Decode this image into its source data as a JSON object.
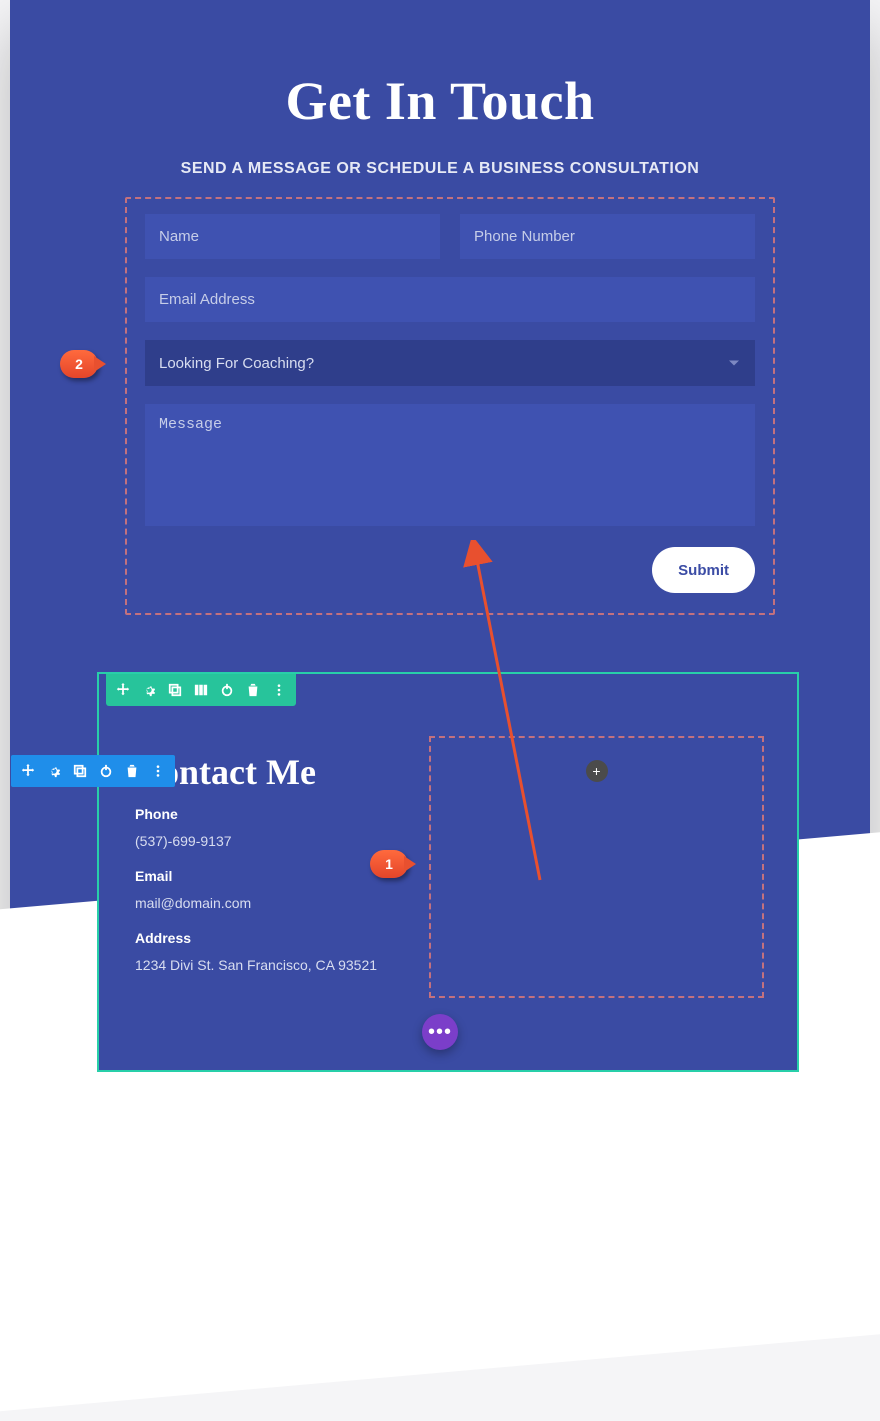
{
  "hero": {
    "title": "Get In Touch",
    "subtitle": "SEND A MESSAGE OR SCHEDULE A BUSINESS CONSULTATION"
  },
  "form": {
    "name_placeholder": "Name",
    "phone_placeholder": "Phone Number",
    "email_placeholder": "Email Address",
    "select_label": "Looking For Coaching?",
    "message_placeholder": "Message",
    "submit_label": "Submit"
  },
  "contact": {
    "title": "Contact Me",
    "phone_label": "Phone",
    "phone_value": "(537)-699-9137",
    "email_label": "Email",
    "email_value": "mail@domain.com",
    "address_label": "Address",
    "address_value": "1234 Divi St. San Francisco, CA 93521"
  },
  "markers": {
    "one": "1",
    "two": "2"
  },
  "fab": {
    "dots": "•••"
  },
  "add": {
    "plus": "+"
  }
}
